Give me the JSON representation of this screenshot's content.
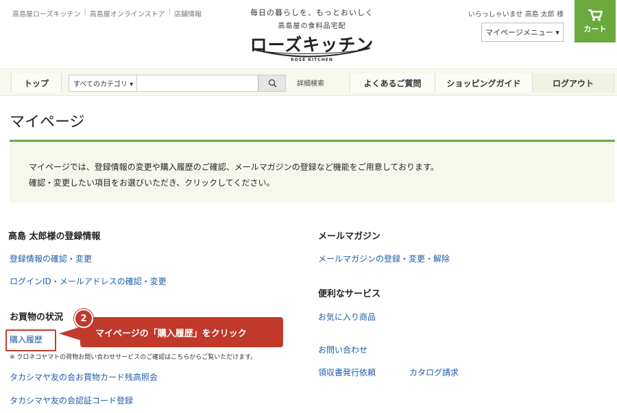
{
  "header": {
    "links": [
      "高島屋ローズキッチン",
      "高島屋オンラインストア",
      "店舗情報"
    ],
    "logo_tagline1": "毎日の暮らしを、もっとおいしく",
    "logo_tagline2": "高島屋の食料品宅配",
    "logo_name": "ローズキッチン",
    "logo_sub": "ROSE KITCHEN",
    "greeting": "いらっしゃいませ 高島 太郎 様",
    "mypage_menu": "マイページメニュー ▾",
    "cart_label": "カート",
    "accent_color": "#6aa93e"
  },
  "nav": {
    "top": "トップ",
    "category_select": "すべてのカテゴリ ▾",
    "search_placeholder": "",
    "advanced_search": "詳細検索",
    "faq": "よくあるご質問",
    "guide": "ショッピングガイド",
    "logout": "ログアウト"
  },
  "page": {
    "title": "マイページ",
    "intro_line1": "マイページでは、登録情報の変更や購入履歴のご確認、メールマガジンの登録など機能をご用意しております。",
    "intro_line2": "確認・変更したい項目をお選びいただき、クリックしてください。"
  },
  "left": {
    "registration_heading": "高島 太郎様の登録情報",
    "registration_links": [
      "登録情報の確認・変更",
      "ログインID・メールアドレスの確認・変更"
    ],
    "shopping_heading": "お買物の状況",
    "purchase_history": "購入履歴",
    "yamato_note": "※ クロネコヤマトの荷物お問い合わせサービスのご確認はこちらからご覧いただけます。",
    "card_balance": "タカシマヤ友の会お買物カード残高照会",
    "auth_code": "タカシマヤ友の会認証コード登録"
  },
  "right": {
    "newsletter_heading": "メールマガジン",
    "newsletter_link": "メールマガジンの登録・変更・解除",
    "services_heading": "便利なサービス",
    "favorites": "お気に入り商品",
    "contact": "お問い合わせ",
    "receipt": "領収書発行依頼",
    "catalog": "カタログ請求"
  },
  "callout": {
    "number": "2",
    "text": "マイページの「購入履歴」をクリック",
    "color": "#c0392b"
  }
}
